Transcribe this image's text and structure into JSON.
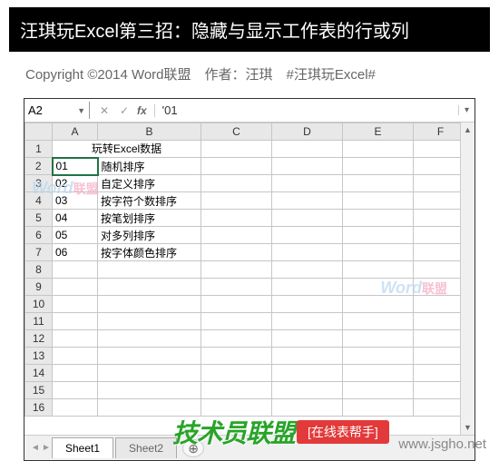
{
  "header": {
    "title_black": "汪琪玩Excel第三招：隐藏与显示工作表的行或列",
    "copyright": "Copyright ©2014 Word联盟　作者：汪琪　#汪琪玩Excel#"
  },
  "namebox": {
    "cell_ref": "A2"
  },
  "formula_bar": {
    "value": "'01"
  },
  "columns": [
    "A",
    "B",
    "C",
    "D",
    "E",
    "F"
  ],
  "row_numbers": [
    1,
    2,
    3,
    4,
    5,
    6,
    7,
    8,
    9,
    10,
    11,
    12,
    13,
    14,
    15,
    16
  ],
  "cells": {
    "merged_row1": "玩转Excel数据",
    "rows": [
      {
        "a": "01",
        "b": "随机排序"
      },
      {
        "a": "02",
        "b": "自定义排序"
      },
      {
        "a": "03",
        "b": "按字符个数排序"
      },
      {
        "a": "04",
        "b": "按笔划排序"
      },
      {
        "a": "05",
        "b": "对多列排序"
      },
      {
        "a": "06",
        "b": "按字体颜色排序"
      }
    ]
  },
  "watermarks": {
    "brand_en": "Word",
    "brand_cn": "联盟"
  },
  "tabs": {
    "active": "Sheet1",
    "inactive": "Sheet2",
    "add": "⊕"
  },
  "bottom": {
    "green_text": "技术员联盟",
    "red_badge": "[在线表帮手]",
    "domain": "www.jsgho.net"
  }
}
